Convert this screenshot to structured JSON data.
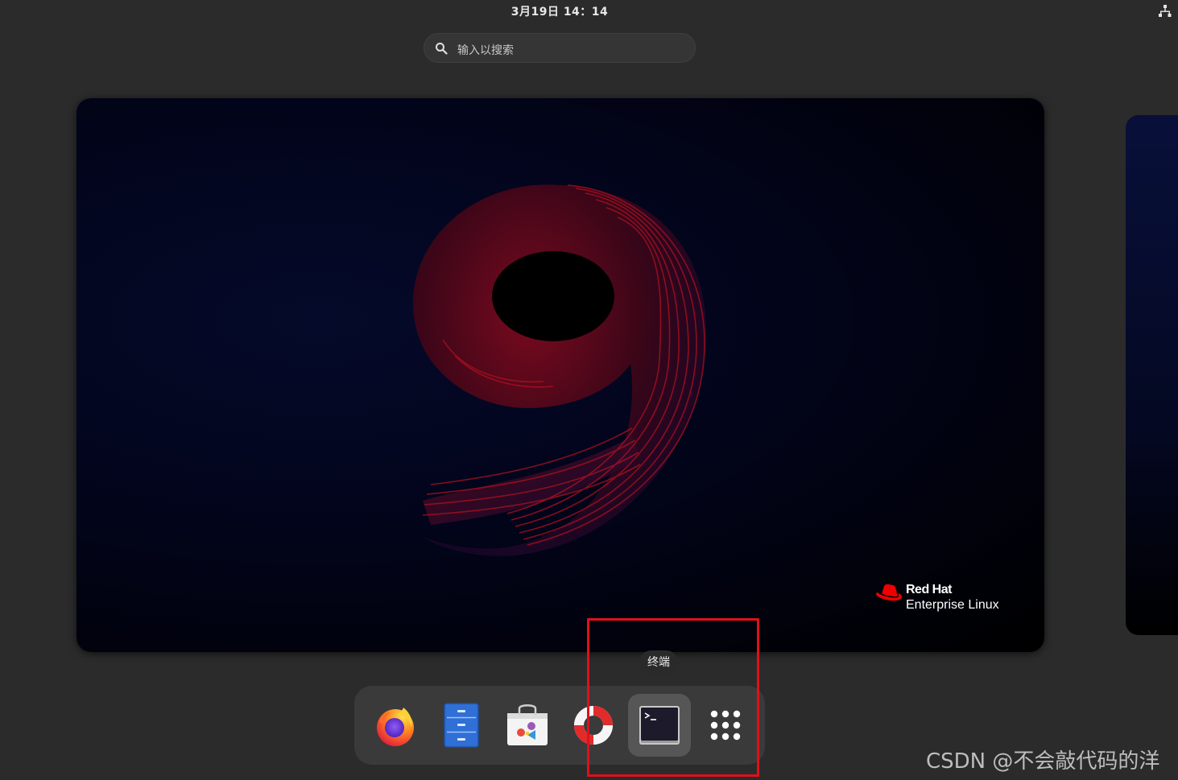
{
  "topbar": {
    "clock": "3月19日 14：14",
    "network_icon": "network-wired-icon"
  },
  "search": {
    "placeholder": "输入以搜索",
    "icon": "search-icon"
  },
  "workspace": {
    "wallpaper_brand": "Red Hat",
    "wallpaper_product": "Enterprise Linux",
    "wallpaper_numeral": "9"
  },
  "dock": {
    "tooltip": "终端",
    "items": [
      {
        "name": "firefox",
        "icon": "firefox-icon",
        "active": false
      },
      {
        "name": "files",
        "icon": "files-cabinet-icon",
        "active": false
      },
      {
        "name": "software",
        "icon": "software-store-icon",
        "active": false
      },
      {
        "name": "help",
        "icon": "help-lifebuoy-icon",
        "active": false
      },
      {
        "name": "terminal",
        "icon": "terminal-icon",
        "active": true
      },
      {
        "name": "show-applications",
        "icon": "app-grid-icon",
        "active": false
      }
    ]
  },
  "annotation": {
    "highlight_color": "#e0101a"
  },
  "watermark": "CSDN @不会敲代码的洋",
  "colors": {
    "background": "#2b2b2b",
    "dock": "#3a3a3a",
    "redhat_red": "#ee0000"
  }
}
